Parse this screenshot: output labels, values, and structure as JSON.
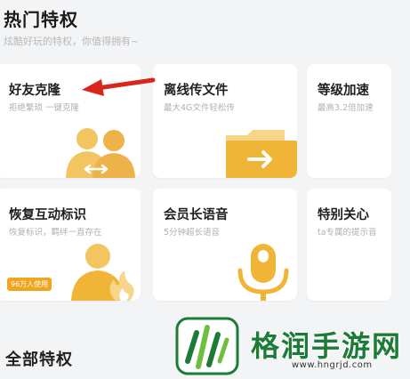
{
  "header": {
    "title": "热门特权",
    "subtitle": "炫酷好玩的特权，你值得拥有~"
  },
  "cards": [
    {
      "title": "好友克隆",
      "desc": "拒绝繁琐 一键克隆"
    },
    {
      "title": "离线传文件",
      "desc": "最大4G文件轻松传"
    },
    {
      "title": "等级加速",
      "desc": "最高3.2倍加速"
    },
    {
      "title": "恢复互动标识",
      "desc": "恢复标识，羁绊一直存在",
      "badge": "96万人使用"
    },
    {
      "title": "会员长语音",
      "desc": "5分钟超长语音"
    },
    {
      "title": "特别关心",
      "desc": "ta专属的提示音"
    }
  ],
  "section": {
    "title": "全部特权"
  },
  "watermark": {
    "name": "格润手游网",
    "url": "www.hngrjd.com"
  },
  "colors": {
    "accent": "#f0b437",
    "badge": "#f0a51f",
    "arrow": "#d9261c",
    "watermark_green": "#1d7b38"
  },
  "icons": [
    "friends-clone-icon",
    "folder-arrow-icon",
    "silhouette-flame-icon",
    "microphone-icon"
  ]
}
